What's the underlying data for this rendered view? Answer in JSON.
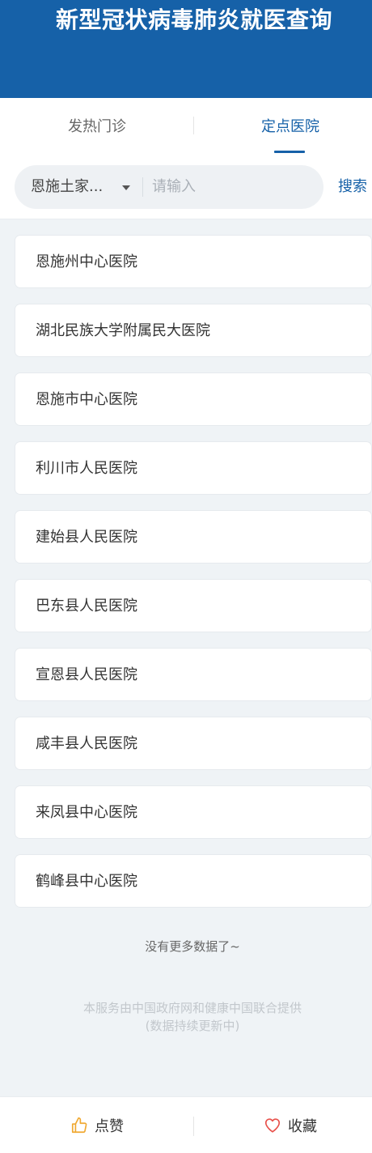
{
  "header": {
    "title": "新型冠状病毒肺炎就医查询"
  },
  "tabs": [
    {
      "label": "发热门诊",
      "active": false
    },
    {
      "label": "定点医院",
      "active": true
    }
  ],
  "search": {
    "region": "恩施土家...",
    "placeholder": "请输入",
    "value": "",
    "button_label": "搜索"
  },
  "hospitals": [
    "恩施州中心医院",
    "湖北民族大学附属民大医院",
    "恩施市中心医院",
    "利川市人民医院",
    "建始县人民医院",
    "巴东县人民医院",
    "宣恩县人民医院",
    "咸丰县人民医院",
    "来凤县中心医院",
    "鹤峰县中心医院"
  ],
  "list_end_text": "没有更多数据了~",
  "footer": {
    "line1": "本服务由中国政府网和健康中国联合提供",
    "line2": "(数据持续更新中)"
  },
  "bottom_bar": {
    "like_label": "点赞",
    "like_icon": "thumbs-up-icon",
    "favorite_label": "收藏",
    "favorite_icon": "heart-icon"
  },
  "colors": {
    "primary": "#1661a8",
    "background": "#eff3f6",
    "like_icon": "#f0a830",
    "favorite_icon": "#e8504a"
  }
}
